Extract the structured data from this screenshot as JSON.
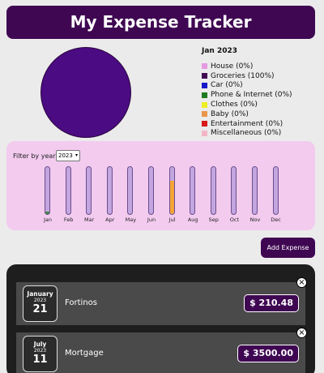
{
  "app": {
    "title": "My Expense Tracker"
  },
  "pie": {
    "color": "#4b0b82"
  },
  "legend": {
    "month": "Jan 2023",
    "items": [
      {
        "label": "House (0%)",
        "color": "#e59ae2"
      },
      {
        "label": "Groceries (100%)",
        "color": "#3f0752"
      },
      {
        "label": "Car (0%)",
        "color": "#1515c8"
      },
      {
        "label": "Phone & Internet (0%)",
        "color": "#1f7a1f"
      },
      {
        "label": "Clothes (0%)",
        "color": "#eeee22"
      },
      {
        "label": "Baby (0%)",
        "color": "#e8964a"
      },
      {
        "label": "Entertainment (0%)",
        "color": "#d71a1a"
      },
      {
        "label": "Miscellaneous (0%)",
        "color": "#f2b7c7"
      }
    ]
  },
  "filter": {
    "label": "Filter by year",
    "selected_year": "2023"
  },
  "chart_data": {
    "type": "bar",
    "categories": [
      "Jan",
      "Feb",
      "Mar",
      "Apr",
      "May",
      "Jun",
      "Jul",
      "Aug",
      "Sep",
      "Oct",
      "Nov",
      "Dec"
    ],
    "values": [
      0.05,
      0,
      0,
      0,
      0,
      0,
      0.7,
      0,
      0,
      0,
      0,
      0
    ],
    "fill_colors": [
      "#3f8a3f",
      "#c3a6e0",
      "#c3a6e0",
      "#c3a6e0",
      "#c3a6e0",
      "#c3a6e0",
      "#f5a43a",
      "#c3a6e0",
      "#c3a6e0",
      "#c3a6e0",
      "#c3a6e0",
      "#c3a6e0"
    ],
    "title": "",
    "xlabel": "",
    "ylabel": "",
    "ylim": [
      0,
      1
    ]
  },
  "actions": {
    "add_label": "Add Expense"
  },
  "expenses": [
    {
      "month": "January",
      "year": "2023",
      "day": "21",
      "title": "Fortinos",
      "amount": "$ 210.48"
    },
    {
      "month": "July",
      "year": "2023",
      "day": "11",
      "title": "Mortgage",
      "amount": "$ 3500.00"
    }
  ]
}
